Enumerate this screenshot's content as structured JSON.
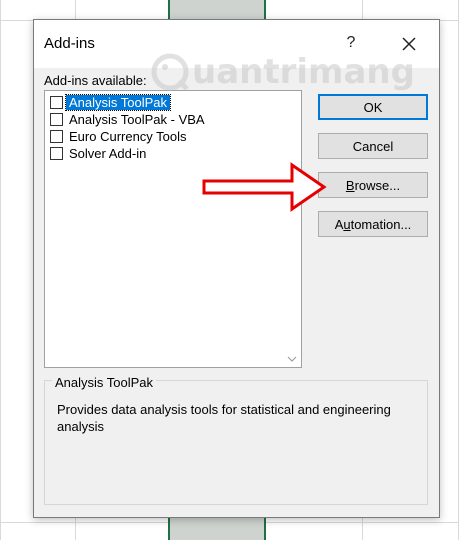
{
  "colors": {
    "accent": "#0078d7",
    "arrow": "#e60000",
    "sheet_selection": "#1e7145"
  },
  "dialog": {
    "title": "Add-ins",
    "help_label": "?",
    "close_icon": "close-icon"
  },
  "list": {
    "label": "Add-ins available:",
    "items": [
      {
        "label": "Analysis ToolPak",
        "checked": false,
        "selected": true
      },
      {
        "label": "Analysis ToolPak - VBA",
        "checked": false,
        "selected": false
      },
      {
        "label": "Euro Currency Tools",
        "checked": false,
        "selected": false
      },
      {
        "label": "Solver Add-in",
        "checked": false,
        "selected": false
      }
    ]
  },
  "buttons": {
    "ok": "OK",
    "cancel": "Cancel",
    "browse_prefix": "",
    "browse_mnemonic": "B",
    "browse_rest": "rowse...",
    "automation_prefix": "A",
    "automation_mnemonic": "u",
    "automation_rest": "tomation..."
  },
  "description": {
    "title": "Analysis ToolPak",
    "text": "Provides data analysis tools for statistical and engineering analysis"
  },
  "watermark": {
    "text": "uantrimang"
  }
}
